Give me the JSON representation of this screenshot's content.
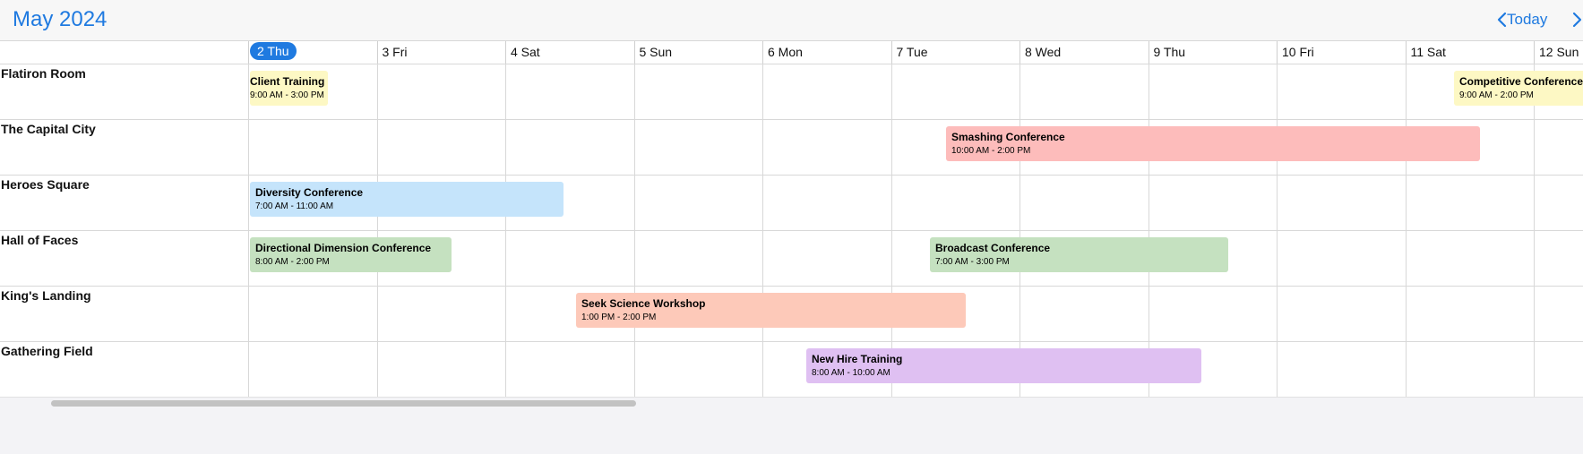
{
  "header": {
    "title": "May 2024",
    "today_label": "Today"
  },
  "days": [
    "2 Thu",
    "3 Fri",
    "4 Sat",
    "5 Sun",
    "6 Mon",
    "7 Tue",
    "8 Wed",
    "9 Thu",
    "10 Fri",
    "11 Sat",
    "12 Sun"
  ],
  "today_index": 0,
  "resources": [
    "Flatiron Room",
    "The Capital City",
    "Heroes Square",
    "Hall of Faces",
    "King's Landing",
    "Gathering Field"
  ],
  "events": [
    {
      "title": "Client Training",
      "time": "9:00 AM - 3:00 PM",
      "resource": 0,
      "start": 0.0,
      "end": 0.62,
      "color": "#fdf8c4"
    },
    {
      "title": "Competitive Conference",
      "time": "9:00 AM - 2:00 PM",
      "resource": 0,
      "start": 9.38,
      "end": 11.4,
      "color": "#fdf8c4"
    },
    {
      "title": "Smashing Conference",
      "time": "10:00 AM - 2:00 PM",
      "resource": 1,
      "start": 5.43,
      "end": 9.58,
      "color": "#fdbcbb"
    },
    {
      "title": "Diversity Conference",
      "time": "7:00 AM - 11:00 AM",
      "resource": 2,
      "start": 0.0,
      "end": 2.45,
      "color": "#c5e4fb"
    },
    {
      "title": "Directional Dimension Conference",
      "time": "8:00 AM - 2:00 PM",
      "resource": 3,
      "start": 0.0,
      "end": 1.58,
      "color": "#c5e1c0"
    },
    {
      "title": "Broadcast Conference",
      "time": "7:00 AM - 3:00 PM",
      "resource": 3,
      "start": 5.3,
      "end": 7.62,
      "color": "#c5e1c0"
    },
    {
      "title": "Seek Science Workshop",
      "time": "1:00 PM - 2:00 PM",
      "resource": 4,
      "start": 2.55,
      "end": 5.58,
      "color": "#fdc9b9"
    },
    {
      "title": "New Hire Training",
      "time": "8:00 AM - 10:00 AM",
      "resource": 5,
      "start": 4.34,
      "end": 7.41,
      "color": "#dfc0f2"
    }
  ],
  "scroll_position": 0.0
}
